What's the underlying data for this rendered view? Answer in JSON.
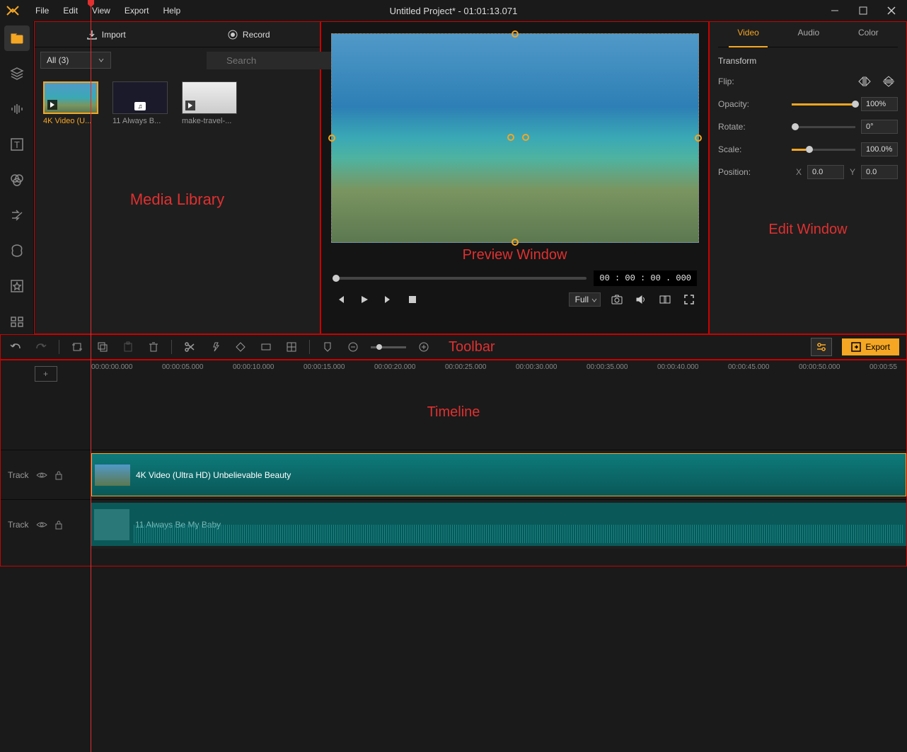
{
  "titlebar": {
    "title": "Untitled Project* - 01:01:13.071",
    "menu": [
      "File",
      "Edit",
      "View",
      "Export",
      "Help"
    ]
  },
  "media": {
    "import_label": "Import",
    "record_label": "Record",
    "filter_label": "All (3)",
    "search_placeholder": "Search",
    "items": [
      {
        "name": "4K Video (U..."
      },
      {
        "name": "11 Always B..."
      },
      {
        "name": "make-travel-..."
      }
    ],
    "panel_label": "Media Library"
  },
  "preview": {
    "panel_label": "Preview Window",
    "timecode": "00 : 00 : 00 . 000",
    "quality_label": "Full"
  },
  "edit": {
    "tabs": [
      "Video",
      "Audio",
      "Color"
    ],
    "section": "Transform",
    "flip_label": "Flip:",
    "opacity_label": "Opacity:",
    "opacity_value": "100%",
    "rotate_label": "Rotate:",
    "rotate_value": "0°",
    "scale_label": "Scale:",
    "scale_value": "100.0%",
    "position_label": "Position:",
    "pos_x_label": "X",
    "pos_x": "0.0",
    "pos_y_label": "Y",
    "pos_y": "0.0",
    "panel_label": "Edit Window"
  },
  "toolbar": {
    "label": "Toolbar",
    "export_label": "Export"
  },
  "timeline": {
    "label": "Timeline",
    "ticks": [
      "00:00:00.000",
      "00:00:05.000",
      "00:00:10.000",
      "00:00:15.000",
      "00:00:20.000",
      "00:00:25.000",
      "00:00:30.000",
      "00:00:35.000",
      "00:00:40.000",
      "00:00:45.000",
      "00:00:50.000",
      "00:00:55"
    ],
    "track_label": "Track",
    "clip1_name": "4K Video (Ultra HD) Unbelievable Beauty",
    "clip2_name": "11 Always Be My Baby"
  }
}
